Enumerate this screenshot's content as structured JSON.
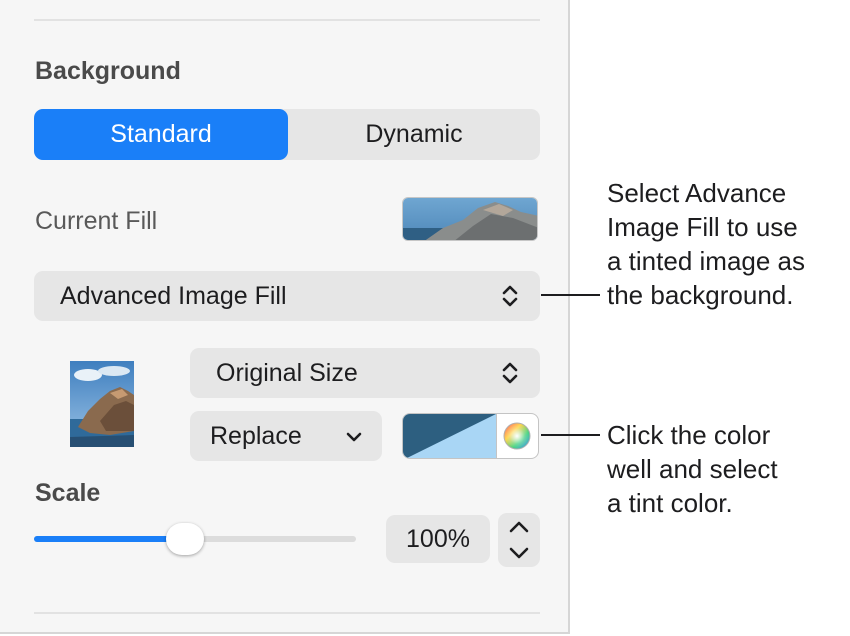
{
  "background": {
    "heading": "Background",
    "tabs": [
      {
        "label": "Standard",
        "selected": true
      },
      {
        "label": "Dynamic",
        "selected": false
      }
    ],
    "current_fill_label": "Current Fill",
    "fill_type": "Advanced Image Fill",
    "image_scaling": "Original Size",
    "replace_label": "Replace",
    "tint_color": "#2d5f80",
    "tint_light": "#a9d6f5",
    "scale_label": "Scale",
    "scale_value": "100%",
    "scale_fraction": 0.47,
    "accent_color": "#1a7ff8"
  },
  "callouts": {
    "fill": "Select Advance\nImage Fill to use\na tinted image as\nthe background.",
    "color": "Click the color\nwell and select\na tint color."
  }
}
